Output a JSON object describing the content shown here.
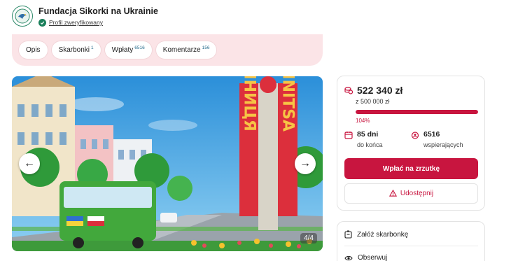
{
  "org": {
    "name": "Fundacja Sikorki na Ukrainie",
    "verified_label": "Profil zweryfikowany"
  },
  "tabs": [
    {
      "label": "Opis",
      "count": ""
    },
    {
      "label": "Skarbonki",
      "count": "1"
    },
    {
      "label": "Wpłaty",
      "count": "6516"
    },
    {
      "label": "Komentarze",
      "count": "156"
    }
  ],
  "carousel": {
    "counter": "4/4",
    "sign_left": "ВІННИЦЯ",
    "sign_right": "VINNITSA"
  },
  "donation": {
    "raised": "522 340 zł",
    "goal": "z 500 000 zł",
    "percent_label": "104%",
    "progress_fraction": 1.0,
    "days_value": "85 dni",
    "days_label": "do końca",
    "supporters_value": "6516",
    "supporters_label": "wspierających",
    "donate_label": "Wpłać na zrzutkę",
    "share_label": "Udostępnij"
  },
  "actions": {
    "create_piggybank": "Załóż skarbonkę",
    "follow": "Obserwuj"
  },
  "colors": {
    "accent": "#c8153f",
    "tab_band": "#fbe4e7",
    "verified": "#1a7f5a"
  }
}
